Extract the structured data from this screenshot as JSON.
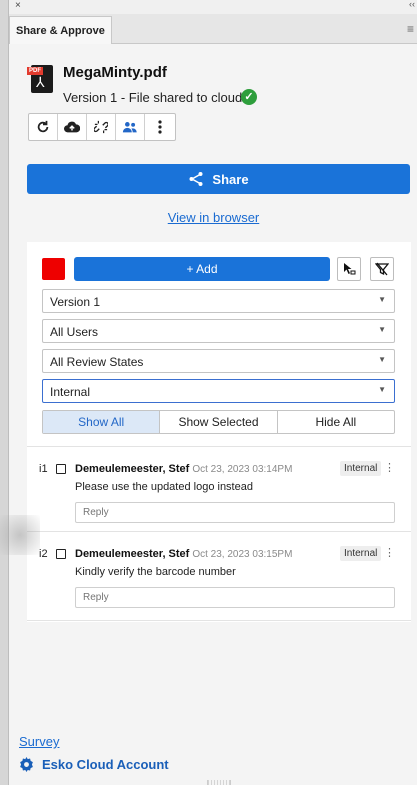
{
  "window": {
    "close_glyph": "×",
    "collapse_glyph": "‹‹"
  },
  "tab": {
    "label": "Share & Approve",
    "menu_icon": "hamburger-icon"
  },
  "file": {
    "pdf_badge": "PDF",
    "name": "MegaMinty.pdf",
    "status": "Version 1 - File shared to cloud",
    "status_color": "#2e9e3c"
  },
  "toolbar": {
    "buttons": [
      {
        "icon": "refresh-icon"
      },
      {
        "icon": "cloud-upload-icon"
      },
      {
        "icon": "unlink-icon"
      },
      {
        "icon": "people-icon"
      },
      {
        "icon": "more-vertical-icon"
      }
    ]
  },
  "share": {
    "label": "Share",
    "color": "#1a73d9"
  },
  "view_in_browser": "View in browser",
  "review": {
    "annotation_color": "#ee0000",
    "add_label": "+ Add",
    "filters": [
      "Version 1",
      "All Users",
      "All Review States",
      "Internal"
    ],
    "segments": [
      "Show All",
      "Show Selected",
      "Hide All"
    ],
    "active_segment": "Show All",
    "comments": [
      {
        "index": "i1",
        "author": "Demeulemeester, Stef",
        "date": "Oct 23, 2023 03:14PM",
        "badge": "Internal",
        "text": "Please use the updated logo instead",
        "reply_placeholder": "Reply"
      },
      {
        "index": "i2",
        "author": "Demeulemeester, Stef",
        "date": "Oct 23, 2023 03:15PM",
        "badge": "Internal",
        "text": "Kindly verify the barcode number",
        "reply_placeholder": "Reply"
      }
    ]
  },
  "footer": {
    "survey": "Survey",
    "account": "Esko Cloud Account"
  }
}
